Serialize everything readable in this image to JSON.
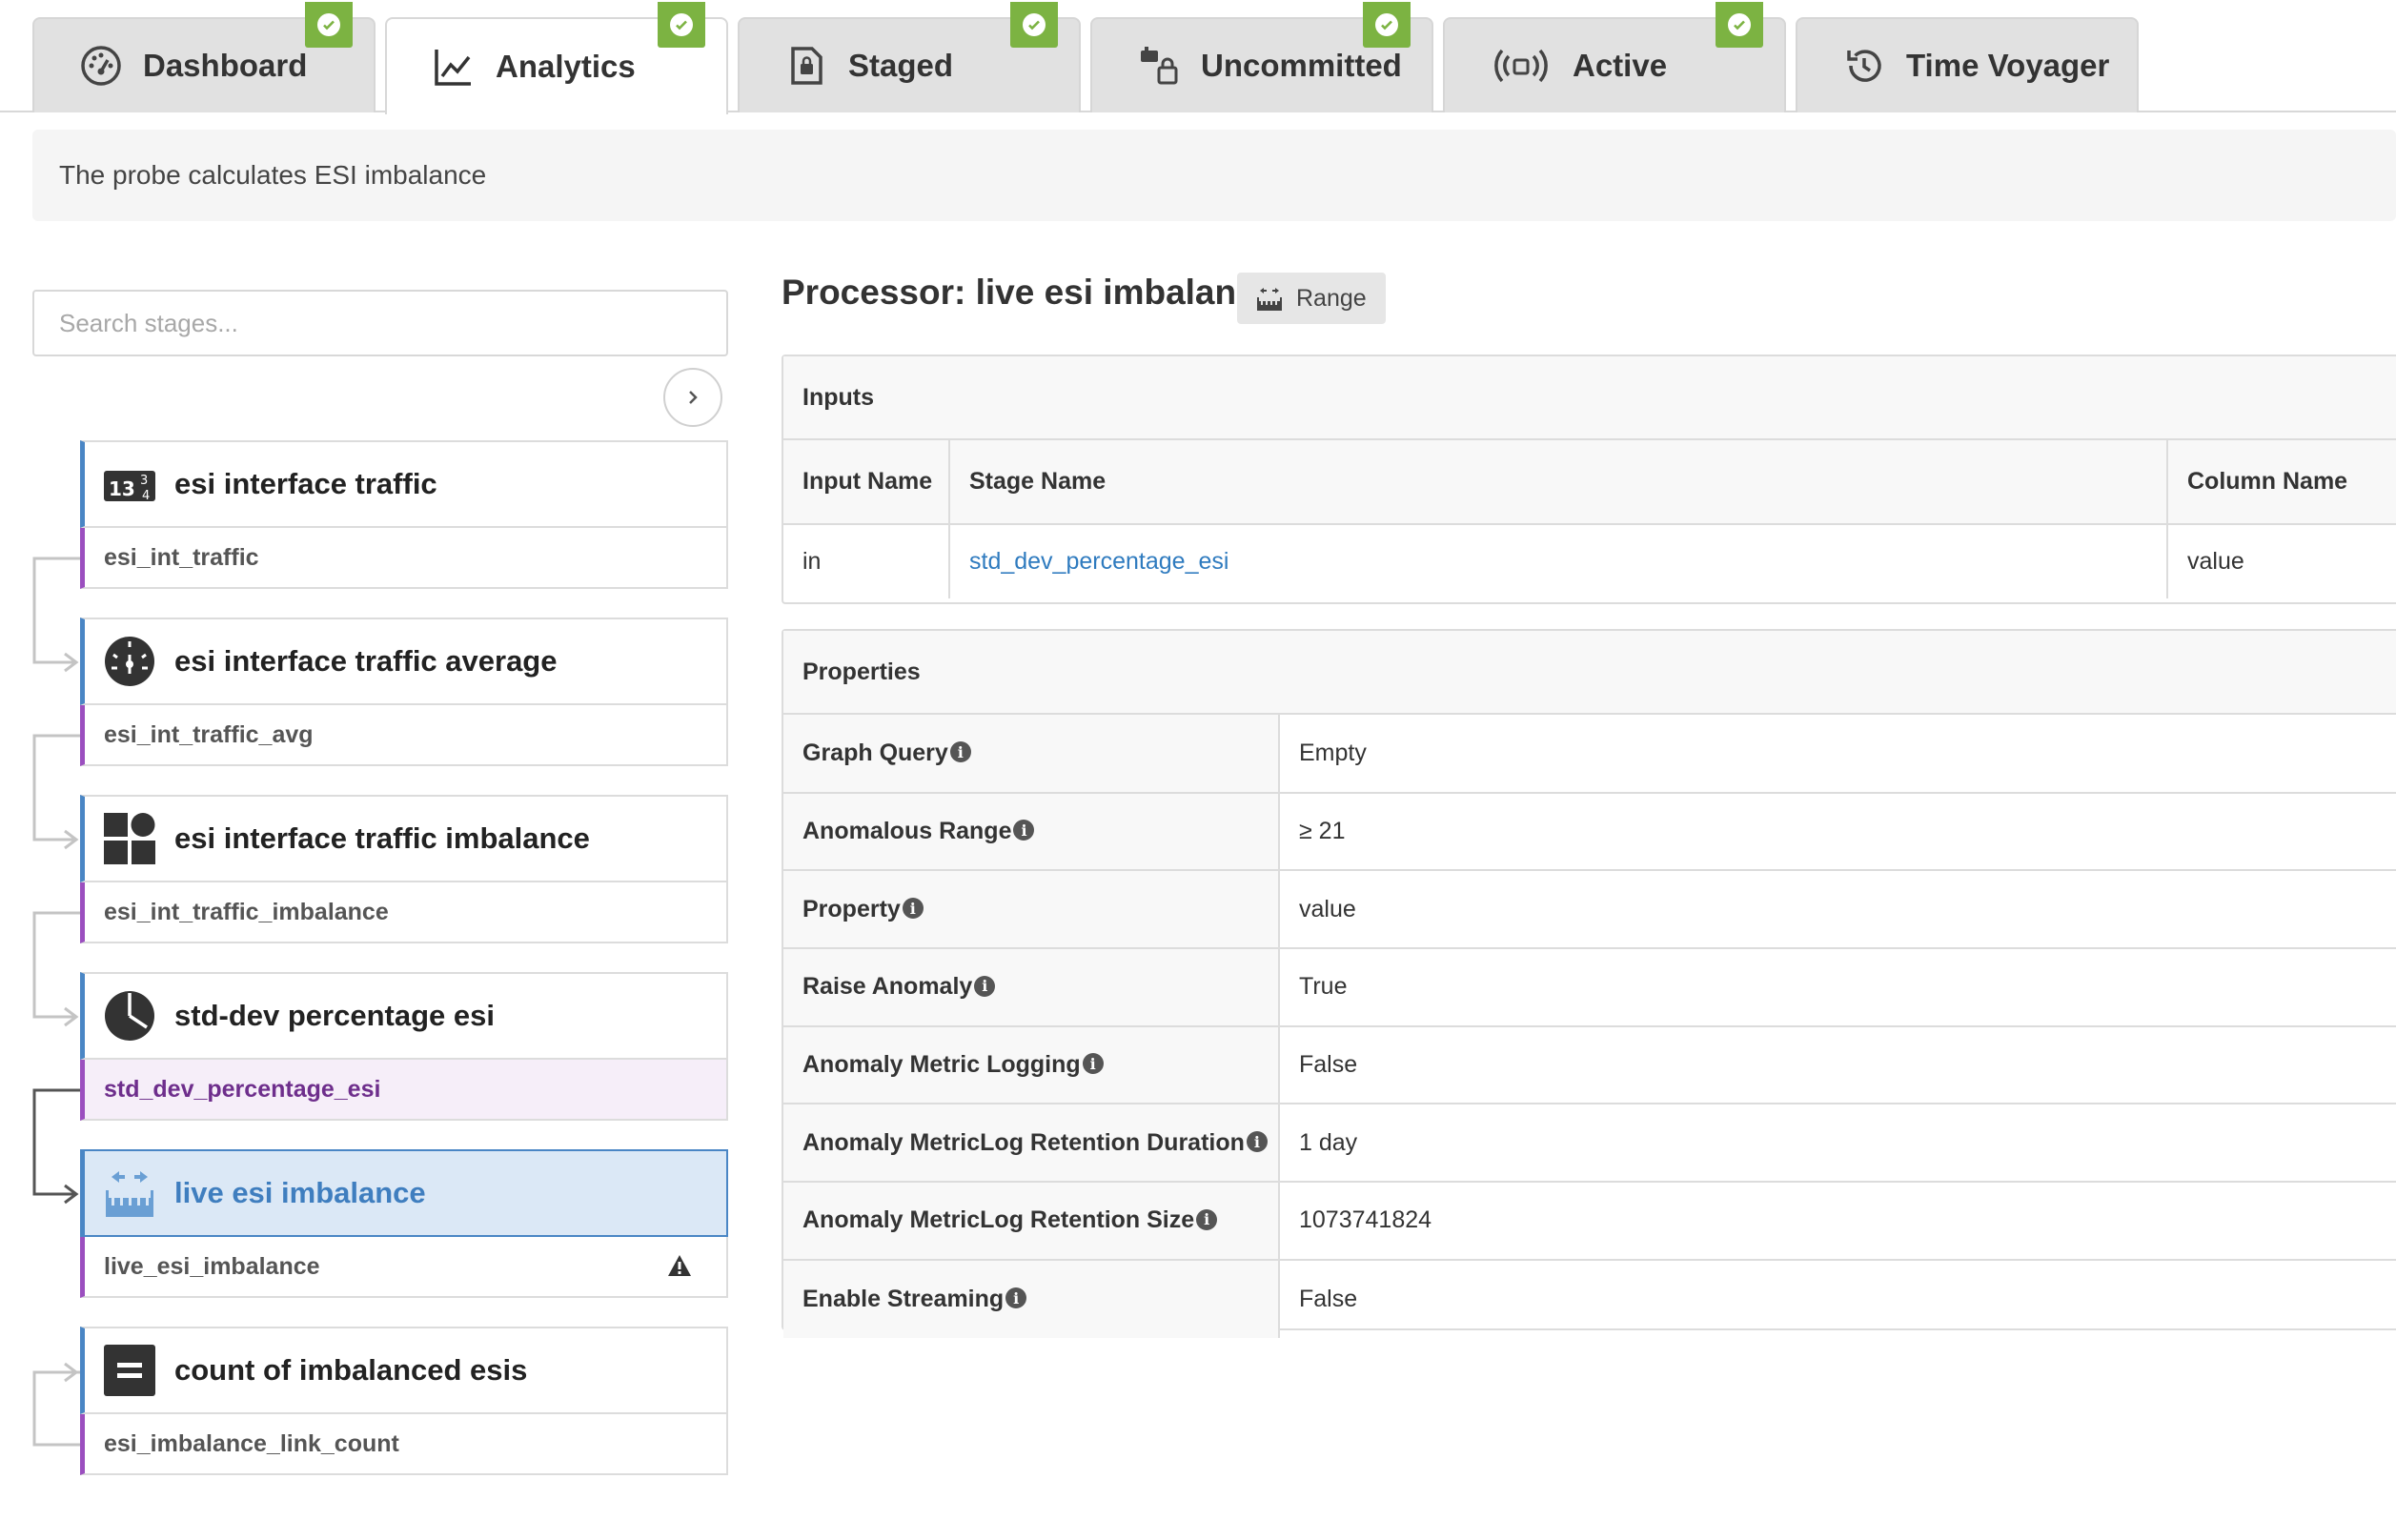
{
  "tabs": [
    {
      "label": "Dashboard",
      "icon": "dashboard-gauge-icon",
      "checked": true
    },
    {
      "label": "Analytics",
      "icon": "analytics-chart-icon",
      "checked": true,
      "active": true
    },
    {
      "label": "Staged",
      "icon": "staged-document-icon",
      "checked": true
    },
    {
      "label": "Uncommitted",
      "icon": "uncommitted-icon",
      "checked": true
    },
    {
      "label": "Active",
      "icon": "active-broadcast-icon",
      "checked": true
    },
    {
      "label": "Time Voyager",
      "icon": "history-icon",
      "checked": false
    }
  ],
  "description": "The probe calculates ESI imbalance",
  "search": {
    "placeholder": "Search stages..."
  },
  "stages": [
    {
      "name": "esi interface traffic",
      "output": "esi_int_traffic",
      "icon": "numbers-icon"
    },
    {
      "name": "esi interface traffic average",
      "output": "esi_int_traffic_avg",
      "icon": "average-gauge-icon"
    },
    {
      "name": "esi interface traffic imbalance",
      "output": "esi_int_traffic_imbalance",
      "icon": "grid-shapes-icon"
    },
    {
      "name": "std-dev percentage esi",
      "output": "std_dev_percentage_esi",
      "icon": "pie-icon"
    },
    {
      "name": "live esi imbalance",
      "output": "live_esi_imbalance",
      "icon": "range-icon",
      "selected": true,
      "warning": true
    },
    {
      "name": "count of imbalanced esis",
      "output": "esi_imbalance_link_count",
      "icon": "equals-icon"
    }
  ],
  "processor": {
    "title": "Processor: live esi imbalance",
    "type_label": "Range"
  },
  "inputs": {
    "title": "Inputs",
    "headers": [
      "Input Name",
      "Stage Name",
      "Column Name"
    ],
    "rows": [
      [
        "in",
        "std_dev_percentage_esi",
        "value"
      ]
    ]
  },
  "properties": {
    "title": "Properties",
    "rows": [
      {
        "key": "Graph Query",
        "value": "Empty"
      },
      {
        "key": "Anomalous Range",
        "value": "≥ 21"
      },
      {
        "key": "Property",
        "value": "value"
      },
      {
        "key": "Raise Anomaly",
        "value": "True"
      },
      {
        "key": "Anomaly Metric Logging",
        "value": "False"
      },
      {
        "key": "Anomaly MetricLog Retention Duration",
        "value": "1 day"
      },
      {
        "key": "Anomaly MetricLog Retention Size",
        "value": "1073741824"
      },
      {
        "key": "Enable Streaming",
        "value": "False"
      }
    ]
  },
  "colors": {
    "check_green": "#7cb342",
    "stage_blue": "#4a86c5",
    "output_purple": "#9b4fbf",
    "link_blue": "#2f7bbf"
  }
}
